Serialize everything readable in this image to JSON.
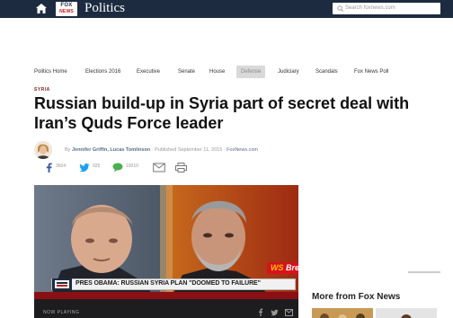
{
  "header": {
    "logo_line1": "FOX",
    "logo_line2": "NEWS",
    "section_title": "Politics",
    "search_placeholder": "Search foxnews.com"
  },
  "nav": {
    "items": [
      {
        "label": "Politics Home"
      },
      {
        "label": "Elections 2016"
      },
      {
        "label": "Executive"
      },
      {
        "label": "Senate"
      },
      {
        "label": "House"
      },
      {
        "label": "Defense",
        "active": true
      },
      {
        "label": "Judiciary"
      },
      {
        "label": "Scandals"
      },
      {
        "label": "Fox News Poll"
      }
    ]
  },
  "article": {
    "kicker": "SYRIA",
    "headline": "Russian build-up in Syria part of secret deal with Iran’s Quds Force leader",
    "byline_prefix": "By",
    "authors": "Jennifer Griffin, Lucas Tomlinson",
    "published": "· Published September 11, 2015 ·",
    "source": "FoxNews.com"
  },
  "share": {
    "facebook_count": "3604",
    "twitter_count": "925",
    "comments_count": "10010"
  },
  "video": {
    "ticker_left": "WS",
    "ticker_right": "Breakin",
    "lower_third": "PRES OBAMA: RUSSIAN SYRIA PLAN \"DOOMED TO FAILURE\"",
    "now_playing": "NOW PLAYING"
  },
  "sidebar": {
    "more_title": "More from Fox News"
  },
  "colors": {
    "header_bg": "#1c2b3f",
    "breaking_red": "#d8121b",
    "facebook": "#3b5998",
    "twitter": "#1da1f2",
    "comments": "#4caf50"
  }
}
